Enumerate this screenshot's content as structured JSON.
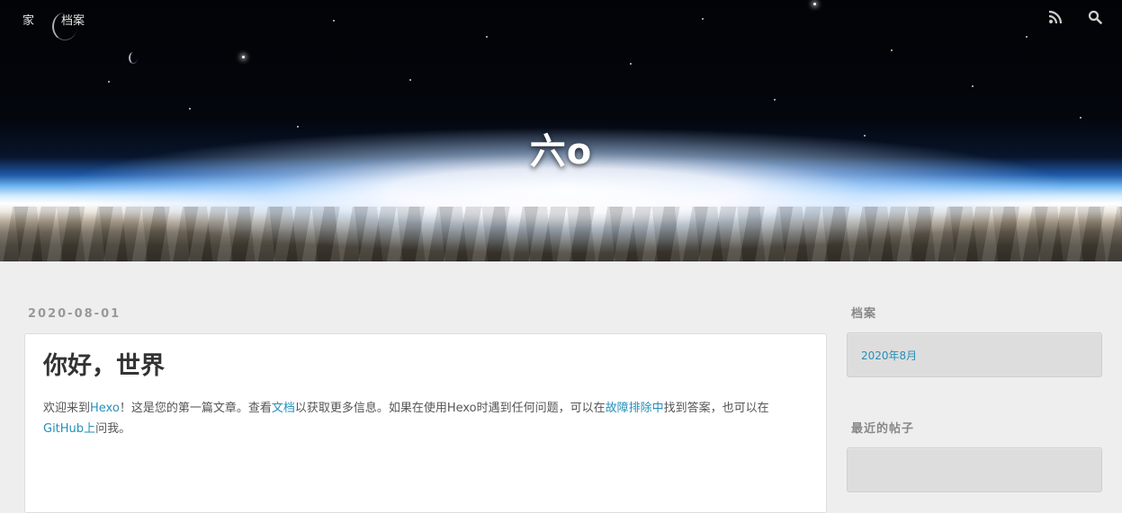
{
  "nav": {
    "home": "家",
    "archives": "档案",
    "rss_icon": "rss-icon",
    "search_icon": "search-icon"
  },
  "site": {
    "title": "六o"
  },
  "post": {
    "date": "2020-08-01",
    "title": "你好，世界",
    "body": {
      "t1": "欢迎来到",
      "link_hexo": "Hexo",
      "t2": "！这是您的第一篇文章。查看",
      "link_docs": "文档",
      "t3": "以获取更多信息。如果在使用Hexo时遇到任何问题，可以在",
      "link_troubleshoot": "故障排除中",
      "t4": "找到答案，也可以在",
      "link_github": "GitHub上",
      "t5": "问我。"
    }
  },
  "sidebar": {
    "archives_title": "档案",
    "archives_items": [
      "2020年8月"
    ],
    "recent_title": "最近的帖子"
  },
  "colors": {
    "link": "#258fb8",
    "page_bg": "#eeeeee"
  }
}
